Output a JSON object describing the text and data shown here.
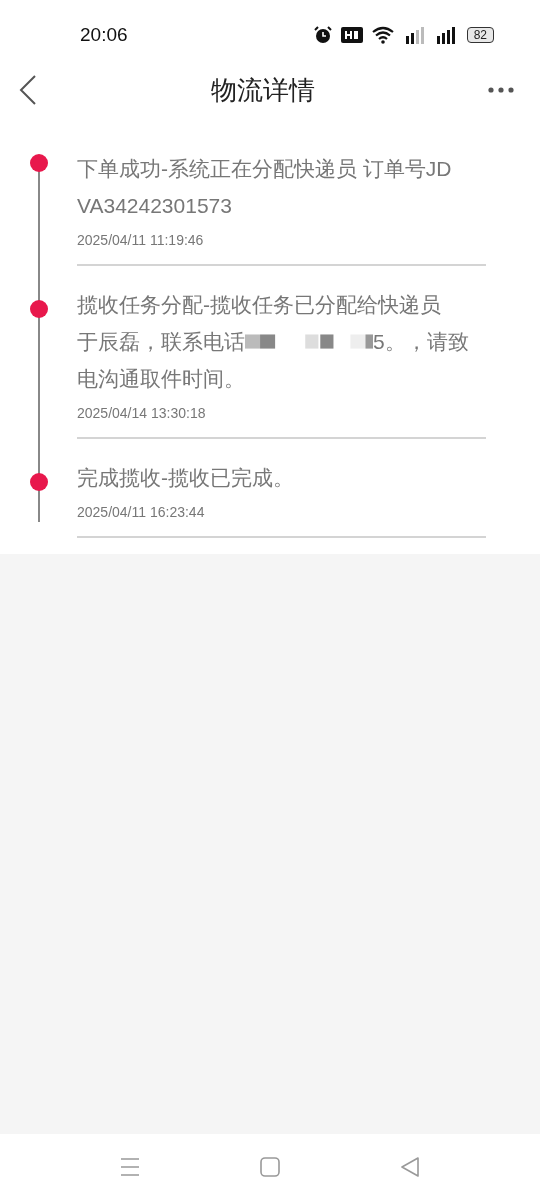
{
  "status_bar": {
    "time": "20:06",
    "battery": "82"
  },
  "header": {
    "title": "物流详情"
  },
  "timeline": [
    {
      "lines": [
        [
          {
            "kind": "text",
            "text": "下单成功-系统正在分配快递员 订单号JD"
          }
        ],
        [
          {
            "kind": "text",
            "text": "VA34242301573"
          }
        ]
      ],
      "time": "2025/04/11 11:19:46"
    },
    {
      "lines": [
        [
          {
            "kind": "text",
            "text": "揽收任务分配-揽收任务已分配给快递员"
          }
        ],
        [
          {
            "kind": "text",
            "text": "于辰磊，联系电话"
          },
          {
            "kind": "redacted"
          },
          {
            "kind": "text",
            "text": "5。，请致"
          }
        ],
        [
          {
            "kind": "text",
            "text": "电沟通取件时间。"
          }
        ]
      ],
      "time": "2025/04/14 13:30:18"
    },
    {
      "lines": [
        [
          {
            "kind": "text",
            "text": "完成揽收-揽收已完成。"
          }
        ]
      ],
      "time": "2025/04/11 16:23:44"
    }
  ]
}
